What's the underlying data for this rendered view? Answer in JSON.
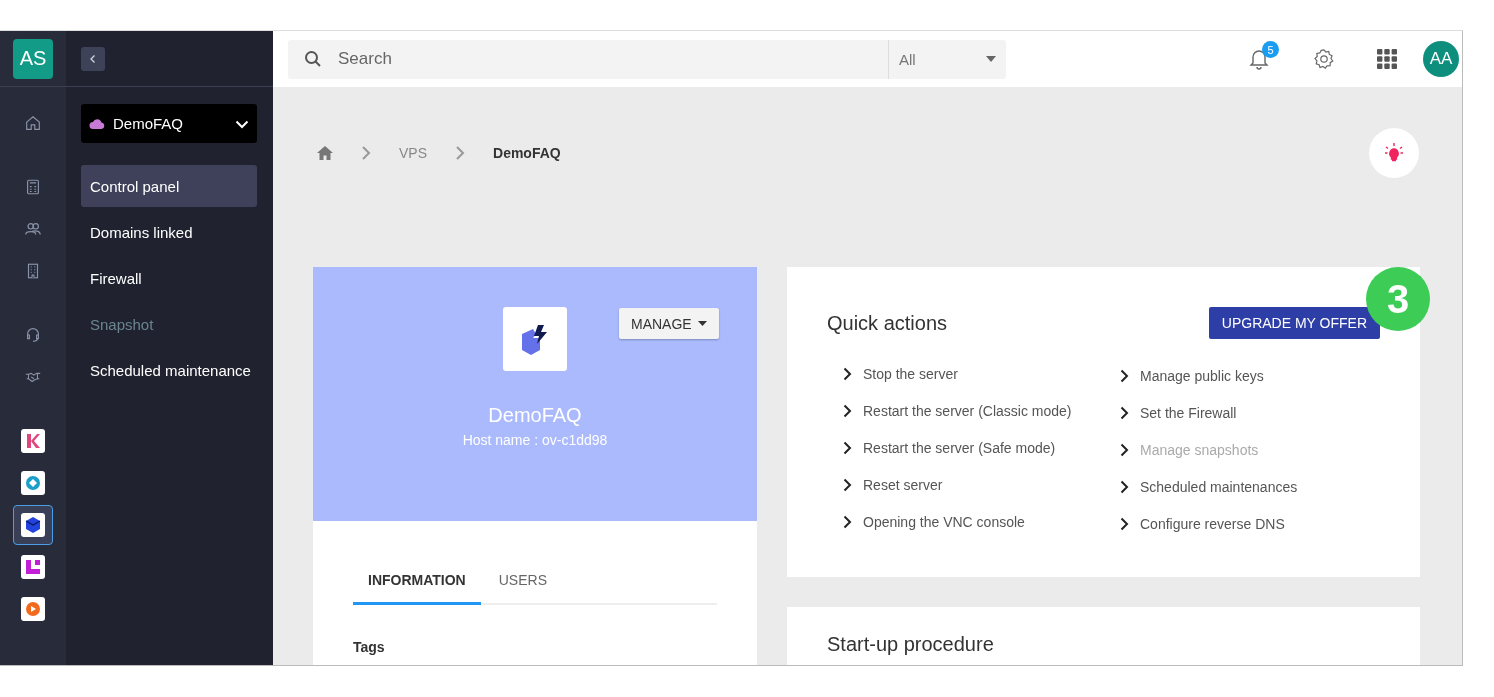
{
  "rail": {
    "account": "AS",
    "apps": [
      {
        "selected": false
      },
      {
        "selected": false
      },
      {
        "selected": true
      },
      {
        "selected": false
      },
      {
        "selected": false
      }
    ]
  },
  "sidebar": {
    "project": "DemoFAQ",
    "items": [
      {
        "label": "Control panel",
        "selected": true,
        "disabled": false
      },
      {
        "label": "Domains linked",
        "selected": false,
        "disabled": false
      },
      {
        "label": "Firewall",
        "selected": false,
        "disabled": false
      },
      {
        "label": "Snapshot",
        "selected": false,
        "disabled": true
      },
      {
        "label": "Scheduled maintenance",
        "selected": false,
        "disabled": false
      }
    ]
  },
  "header": {
    "search": {
      "placeholder": "Search"
    },
    "scope": "All",
    "notifications": "5",
    "avatar": "AA"
  },
  "breadcrumb": [
    "VPS",
    "DemoFAQ"
  ],
  "server": {
    "name": "DemoFAQ",
    "host": "Host name : ov-c1dd98",
    "manage": "MANAGE",
    "tabs": [
      {
        "label": "INFORMATION",
        "selected": true
      },
      {
        "label": "USERS",
        "selected": false
      }
    ],
    "section": "Tags"
  },
  "quick_actions": {
    "title": "Quick actions",
    "upgrade": "UPGRADE MY OFFER",
    "step": "3",
    "columns": [
      [
        {
          "label": "Stop the server",
          "disabled": false
        },
        {
          "label": "Restart the server (Classic mode)",
          "disabled": false
        },
        {
          "label": "Restart the server (Safe mode)",
          "disabled": false
        },
        {
          "label": "Reset server",
          "disabled": false
        },
        {
          "label": "Opening the VNC console",
          "disabled": false
        }
      ],
      [
        {
          "label": "Manage public keys",
          "disabled": false
        },
        {
          "label": "Set the Firewall",
          "disabled": false
        },
        {
          "label": "Manage snapshots",
          "disabled": true
        },
        {
          "label": "Scheduled maintenances",
          "disabled": false
        },
        {
          "label": "Configure reverse DNS",
          "disabled": false
        }
      ]
    ]
  },
  "startup": {
    "title": "Start-up procedure"
  }
}
